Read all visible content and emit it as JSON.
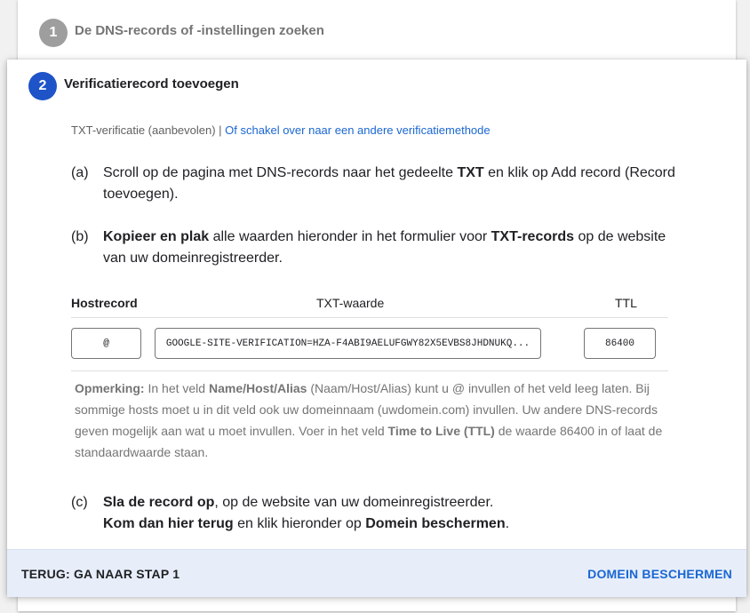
{
  "step1": {
    "number": "1",
    "title": "De DNS-records of -instellingen zoeken"
  },
  "step2": {
    "number": "2",
    "title": "Verificatierecord toevoegen"
  },
  "method": {
    "current": "TXT-verificatie (aanbevolen) | ",
    "switch_link": "Of schakel over naar een andere verificatiemethode"
  },
  "instructions": {
    "a": {
      "label": "(a)",
      "t1": "Scroll op de pagina met DNS-records naar het gedeelte ",
      "b1": "TXT",
      "t2": " en klik op Add record (Record toevoegen)."
    },
    "b": {
      "label": "(b)",
      "b1": "Kopieer en plak",
      "t1": " alle waarden hieronder in het formulier voor ",
      "b2": "TXT-records",
      "t2": " op de website van uw domeinregistreerder."
    },
    "c": {
      "label": "(c)",
      "b1": "Sla de record op",
      "t1": ", op de website van uw domeinregistreerder.",
      "b2": "Kom dan hier terug",
      "t2": " en klik hieronder op ",
      "b3": "Domein beschermen",
      "t3": "."
    }
  },
  "table": {
    "headers": {
      "host": "Hostrecord",
      "txt": "TXT-waarde",
      "ttl": "TTL"
    },
    "host_value": "@",
    "txt_value": "GOOGLE-SITE-VERIFICATION=HZA-F4ABI9AELUFGWY82X5EVBS8JHDNUKQ...",
    "ttl_value": "86400"
  },
  "note": {
    "label": "Opmerking:",
    "t1": " In het veld ",
    "b1": "Name/Host/Alias",
    "t2": " (Naam/Host/Alias) kunt u @ invullen of het veld leeg laten. Bij sommige hosts moet u in dit veld ook uw domeinnaam (uwdomein.com) invullen. Uw andere DNS-records geven mogelijk aan wat u moet invullen. Voer in het veld ",
    "b2": "Time to Live (TTL)",
    "t3": " de waarde 86400 in of laat de standaardwaarde staan."
  },
  "footer": {
    "back_label": "TERUG: GA NAAR STAP 1",
    "protect_label": "DOMEIN BESCHERMEN"
  },
  "colors": {
    "accent": "#1a67d2",
    "step_active": "#1e54c8",
    "step_inactive": "#9e9e9e",
    "footer_bg": "#e7eefa"
  }
}
